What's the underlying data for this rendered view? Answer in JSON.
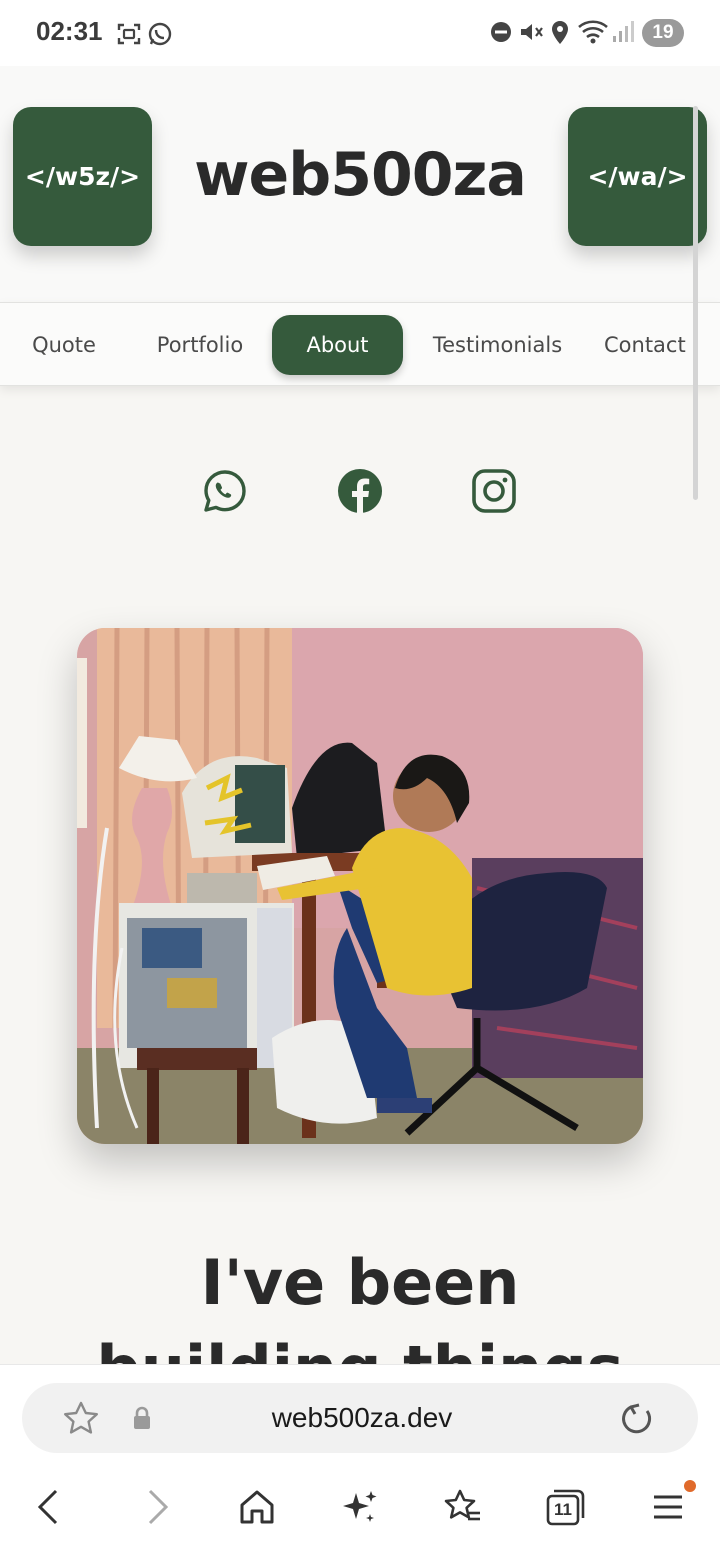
{
  "status_bar": {
    "time": "02:31",
    "battery_level": "19",
    "icons": [
      "screenshot-icon",
      "whatsapp-notification-icon",
      "dnd-icon",
      "mute-icon",
      "location-icon",
      "wifi-icon",
      "signal-icon"
    ]
  },
  "header": {
    "logo_left": "</w5z/>",
    "title": "web500za",
    "logo_right": "</wa/>"
  },
  "nav": {
    "items": [
      {
        "label": "Quote"
      },
      {
        "label": "Portfolio"
      },
      {
        "label": "About"
      },
      {
        "label": "Testimonials"
      },
      {
        "label": "Contact"
      }
    ],
    "active": "About"
  },
  "social": [
    "whatsapp-icon",
    "facebook-icon",
    "instagram-icon"
  ],
  "photo": {
    "subject": "child-at-computer"
  },
  "headline": {
    "line1": "I've been",
    "line2": "building things"
  },
  "browser": {
    "url": "web500za.dev",
    "tab_count": "11"
  },
  "colors": {
    "brand_green": "#355a3c",
    "background": "#f7f6f3",
    "text": "#2a2a2a",
    "notification_dot": "#e06a2b"
  }
}
